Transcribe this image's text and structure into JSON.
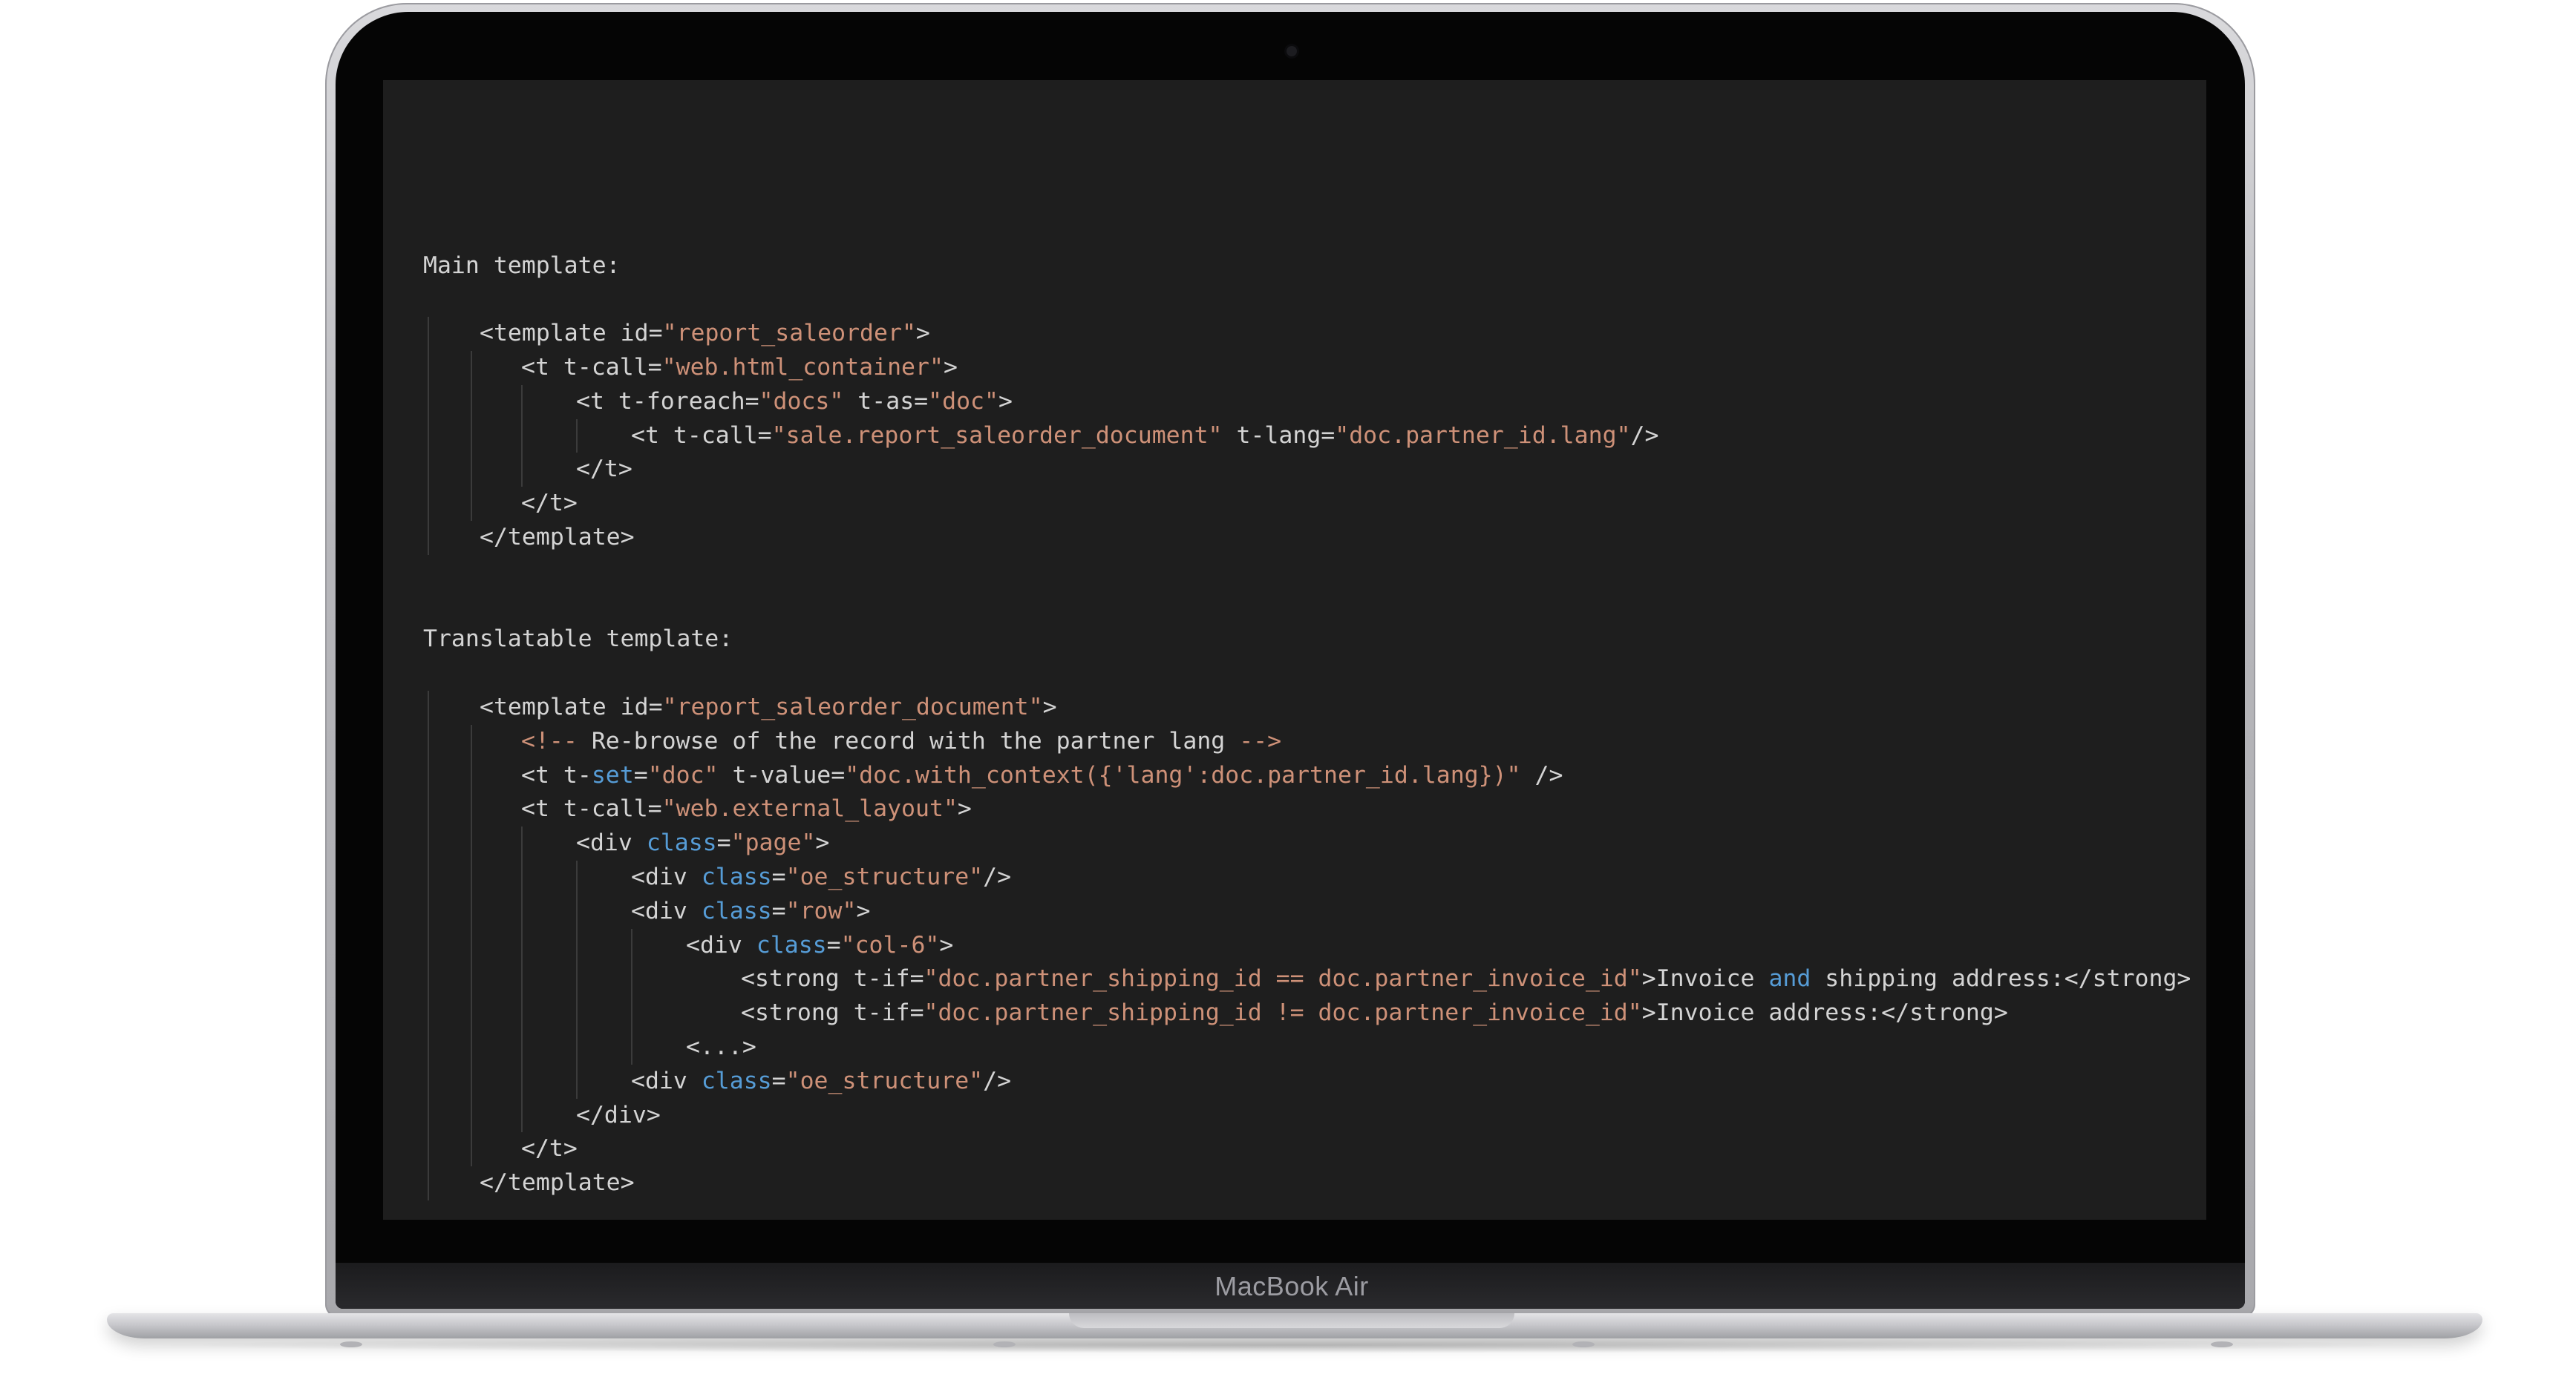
{
  "device": {
    "brand_label": "MacBook Air"
  },
  "colors": {
    "editor_bg": "#1e1e1e",
    "text": "#d4d4d4",
    "string": "#ce9178",
    "keyword": "#569cd6"
  },
  "code": {
    "lines": [
      {
        "indent": 0,
        "tokens": []
      },
      {
        "indent": 0,
        "tokens": []
      },
      {
        "indent": 0,
        "tokens": [
          {
            "t": "Main template:",
            "c": "text"
          }
        ]
      },
      {
        "indent": 0,
        "tokens": []
      },
      {
        "indent": 1,
        "tokens": [
          {
            "t": "<template id=",
            "c": "text"
          },
          {
            "t": "\"report_saleorder\"",
            "c": "str"
          },
          {
            "t": ">",
            "c": "text"
          }
        ]
      },
      {
        "indent": 2,
        "tokens": [
          {
            "t": "<t t-call=",
            "c": "text"
          },
          {
            "t": "\"web.html_container\"",
            "c": "str"
          },
          {
            "t": ">",
            "c": "text"
          }
        ]
      },
      {
        "indent": 3,
        "tokens": [
          {
            "t": "<t t-foreach=",
            "c": "text"
          },
          {
            "t": "\"docs\"",
            "c": "str"
          },
          {
            "t": " t-as=",
            "c": "text"
          },
          {
            "t": "\"doc\"",
            "c": "str"
          },
          {
            "t": ">",
            "c": "text"
          }
        ]
      },
      {
        "indent": 4,
        "tokens": [
          {
            "t": "<t t-call=",
            "c": "text"
          },
          {
            "t": "\"sale.report_saleorder_document\"",
            "c": "str"
          },
          {
            "t": " t-lang=",
            "c": "text"
          },
          {
            "t": "\"doc.partner_id.lang\"",
            "c": "str"
          },
          {
            "t": "/>",
            "c": "text"
          }
        ]
      },
      {
        "indent": 3,
        "tokens": [
          {
            "t": "</t>",
            "c": "text"
          }
        ]
      },
      {
        "indent": 2,
        "tokens": [
          {
            "t": "</t>",
            "c": "text"
          }
        ]
      },
      {
        "indent": 1,
        "tokens": [
          {
            "t": "</template>",
            "c": "text"
          }
        ]
      },
      {
        "indent": 0,
        "tokens": []
      },
      {
        "indent": 0,
        "tokens": []
      },
      {
        "indent": 0,
        "tokens": [
          {
            "t": "Translatable template:",
            "c": "text"
          }
        ]
      },
      {
        "indent": 0,
        "tokens": []
      },
      {
        "indent": 1,
        "tokens": [
          {
            "t": "<template id=",
            "c": "text"
          },
          {
            "t": "\"report_saleorder_document\"",
            "c": "str"
          },
          {
            "t": ">",
            "c": "text"
          }
        ]
      },
      {
        "indent": 2,
        "tokens": [
          {
            "t": "<!-- ",
            "c": "cmtd"
          },
          {
            "t": "Re-browse of the record ",
            "c": "text"
          },
          {
            "t": "with",
            "c": "text"
          },
          {
            "t": " the partner lang ",
            "c": "text"
          },
          {
            "t": "-->",
            "c": "cmtd"
          }
        ]
      },
      {
        "indent": 2,
        "tokens": [
          {
            "t": "<t t-",
            "c": "text"
          },
          {
            "t": "set",
            "c": "kw"
          },
          {
            "t": "=",
            "c": "text"
          },
          {
            "t": "\"doc\"",
            "c": "str"
          },
          {
            "t": " t-value=",
            "c": "text"
          },
          {
            "t": "\"doc.with_context({'lang':doc.partner_id.lang})\"",
            "c": "str"
          },
          {
            "t": " />",
            "c": "text"
          }
        ]
      },
      {
        "indent": 2,
        "tokens": [
          {
            "t": "<t t-call=",
            "c": "text"
          },
          {
            "t": "\"web.external_layout\"",
            "c": "str"
          },
          {
            "t": ">",
            "c": "text"
          }
        ]
      },
      {
        "indent": 3,
        "tokens": [
          {
            "t": "<div ",
            "c": "text"
          },
          {
            "t": "class",
            "c": "kw"
          },
          {
            "t": "=",
            "c": "text"
          },
          {
            "t": "\"page\"",
            "c": "str"
          },
          {
            "t": ">",
            "c": "text"
          }
        ]
      },
      {
        "indent": 4,
        "tokens": [
          {
            "t": "<div ",
            "c": "text"
          },
          {
            "t": "class",
            "c": "kw"
          },
          {
            "t": "=",
            "c": "text"
          },
          {
            "t": "\"oe_structure\"",
            "c": "str"
          },
          {
            "t": "/>",
            "c": "text"
          }
        ]
      },
      {
        "indent": 4,
        "tokens": [
          {
            "t": "<div ",
            "c": "text"
          },
          {
            "t": "class",
            "c": "kw"
          },
          {
            "t": "=",
            "c": "text"
          },
          {
            "t": "\"row\"",
            "c": "str"
          },
          {
            "t": ">",
            "c": "text"
          }
        ]
      },
      {
        "indent": 5,
        "tokens": [
          {
            "t": "<div ",
            "c": "text"
          },
          {
            "t": "class",
            "c": "kw"
          },
          {
            "t": "=",
            "c": "text"
          },
          {
            "t": "\"col-6\"",
            "c": "str"
          },
          {
            "t": ">",
            "c": "text"
          }
        ]
      },
      {
        "indent": 6,
        "tokens": [
          {
            "t": "<strong t-if=",
            "c": "text"
          },
          {
            "t": "\"doc.partner_shipping_id == doc.partner_invoice_id\"",
            "c": "str"
          },
          {
            "t": ">Invoice ",
            "c": "text"
          },
          {
            "t": "and",
            "c": "kw"
          },
          {
            "t": " shipping address:</strong>",
            "c": "text"
          }
        ]
      },
      {
        "indent": 6,
        "tokens": [
          {
            "t": "<strong t-if=",
            "c": "text"
          },
          {
            "t": "\"doc.partner_shipping_id != doc.partner_invoice_id\"",
            "c": "str"
          },
          {
            "t": ">Invoice address:</strong>",
            "c": "text"
          }
        ]
      },
      {
        "indent": 5,
        "tokens": [
          {
            "t": "<...>",
            "c": "text"
          }
        ]
      },
      {
        "indent": 4,
        "tokens": [
          {
            "t": "<div ",
            "c": "text"
          },
          {
            "t": "class",
            "c": "kw"
          },
          {
            "t": "=",
            "c": "text"
          },
          {
            "t": "\"oe_structure\"",
            "c": "str"
          },
          {
            "t": "/>",
            "c": "text"
          }
        ]
      },
      {
        "indent": 3,
        "tokens": [
          {
            "t": "</div>",
            "c": "text"
          }
        ]
      },
      {
        "indent": 2,
        "tokens": [
          {
            "t": "</t>",
            "c": "text"
          }
        ]
      },
      {
        "indent": 1,
        "tokens": [
          {
            "t": "</template>",
            "c": "text"
          }
        ]
      }
    ]
  }
}
